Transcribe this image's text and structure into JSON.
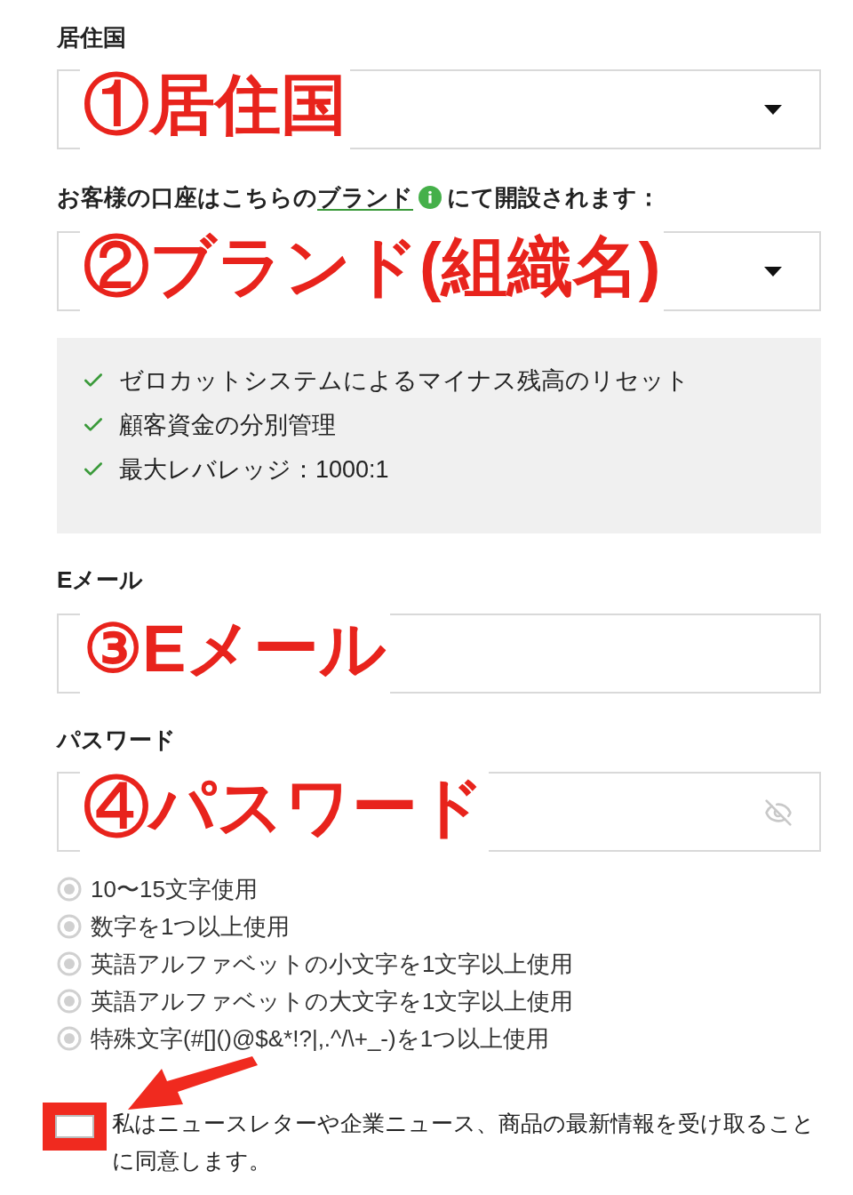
{
  "country": {
    "label": "居住国",
    "annotation": "①居住国"
  },
  "brand": {
    "label_before": "お客様の口座はこちらの",
    "link": "ブランド",
    "label_after": "にて開設されます：",
    "annotation": "②ブランド(組織名)"
  },
  "features": [
    "ゼロカットシステムによるマイナス残高のリセット",
    "顧客資金の分別管理",
    "最大レバレッジ：1000:1"
  ],
  "email": {
    "label": "Eメール",
    "annotation": "③Eメール"
  },
  "password": {
    "label": "パスワード",
    "annotation": "④パスワード"
  },
  "rules": [
    {
      "text": "10〜15文字使用",
      "met": false
    },
    {
      "text": "数字を1つ以上使用",
      "met": false
    },
    {
      "text": "英語アルファベットの小文字を1文字以上使用",
      "met": false
    },
    {
      "text": "英語アルファベットの大文字を1文字以上使用",
      "met": false
    },
    {
      "text": "特殊文字(#[]()@$&*!?|,.^/\\+_-)を1つ以上使用",
      "met": false
    }
  ],
  "newsletter": {
    "text": "私はニュースレターや企業ニュース、商品の最新情報を受け取ることに同意します。",
    "checked": false
  }
}
